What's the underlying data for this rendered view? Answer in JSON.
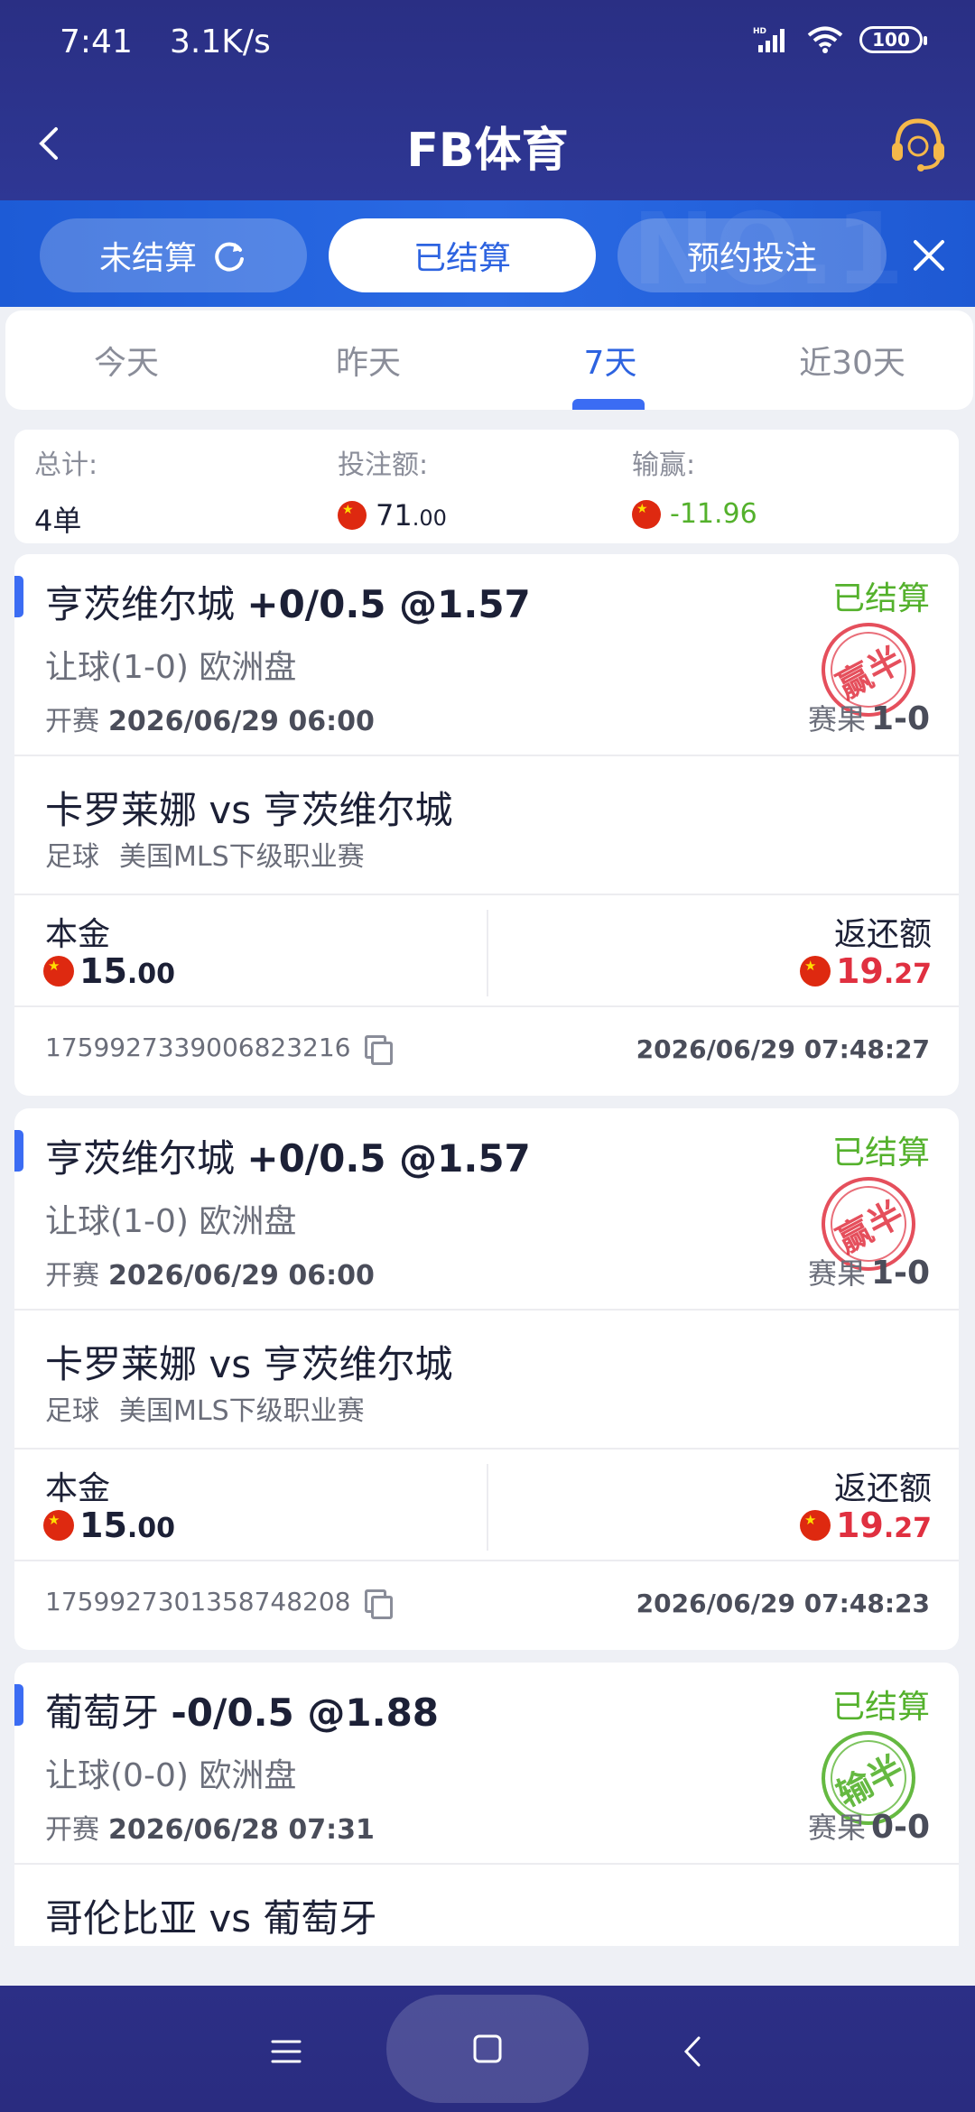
{
  "status_bar": {
    "time": "7:41",
    "speed": "3.1K/s",
    "battery": "100"
  },
  "header": {
    "title": "FB体育"
  },
  "tabs": [
    {
      "label": "未结算"
    },
    {
      "label": "已结算"
    },
    {
      "label": "预约投注"
    }
  ],
  "watermark": "NO.1",
  "day_tabs": [
    {
      "label": "今天"
    },
    {
      "label": "昨天"
    },
    {
      "label": "7天"
    },
    {
      "label": "近30天"
    }
  ],
  "summary": {
    "total_label": "总计:",
    "total_value": "4单",
    "stake_label": "投注额:",
    "stake_int": "71",
    "stake_dec": ".00",
    "winloss_label": "输赢:",
    "winloss_value": "-11.96"
  },
  "colors": {
    "accent": "#3b6cf3",
    "settled_green": "#54b12c",
    "payout_red": "#e03040",
    "header_navy": "#2a2f84"
  },
  "bets": [
    {
      "team": "亨茨维尔城",
      "odds": "+0/0.5 @1.57",
      "status": "已结算",
      "market": "让球(1-0) 欧洲盘",
      "kickoff_label": "开赛",
      "kickoff": "2026/06/29 06:00",
      "result_label": "赛果",
      "result": "1-0",
      "stamp": "赢半",
      "match": "卡罗莱娜 vs 亨茨维尔城",
      "sport": "足球",
      "league": "美国MLS下级职业赛",
      "principal_label": "本金",
      "principal_int": "15",
      "principal_dec": ".00",
      "payout_label": "返还额",
      "payout_int": "19",
      "payout_dec": ".27",
      "order_id": "1759927339006823216",
      "settled_at": "2026/06/29 07:48:27"
    },
    {
      "team": "亨茨维尔城",
      "odds": "+0/0.5 @1.57",
      "status": "已结算",
      "market": "让球(1-0) 欧洲盘",
      "kickoff_label": "开赛",
      "kickoff": "2026/06/29 06:00",
      "result_label": "赛果",
      "result": "1-0",
      "stamp": "赢半",
      "match": "卡罗莱娜 vs 亨茨维尔城",
      "sport": "足球",
      "league": "美国MLS下级职业赛",
      "principal_label": "本金",
      "principal_int": "15",
      "principal_dec": ".00",
      "payout_label": "返还额",
      "payout_int": "19",
      "payout_dec": ".27",
      "order_id": "1759927301358748208",
      "settled_at": "2026/06/29 07:48:23"
    },
    {
      "team": "葡萄牙",
      "odds": "-0/0.5 @1.88",
      "status": "已结算",
      "market": "让球(0-0) 欧洲盘",
      "kickoff_label": "开赛",
      "kickoff": "2026/06/28 07:31",
      "result_label": "赛果",
      "result": "0-0",
      "stamp": "输半",
      "match": "哥伦比亚 vs 葡萄牙"
    }
  ]
}
